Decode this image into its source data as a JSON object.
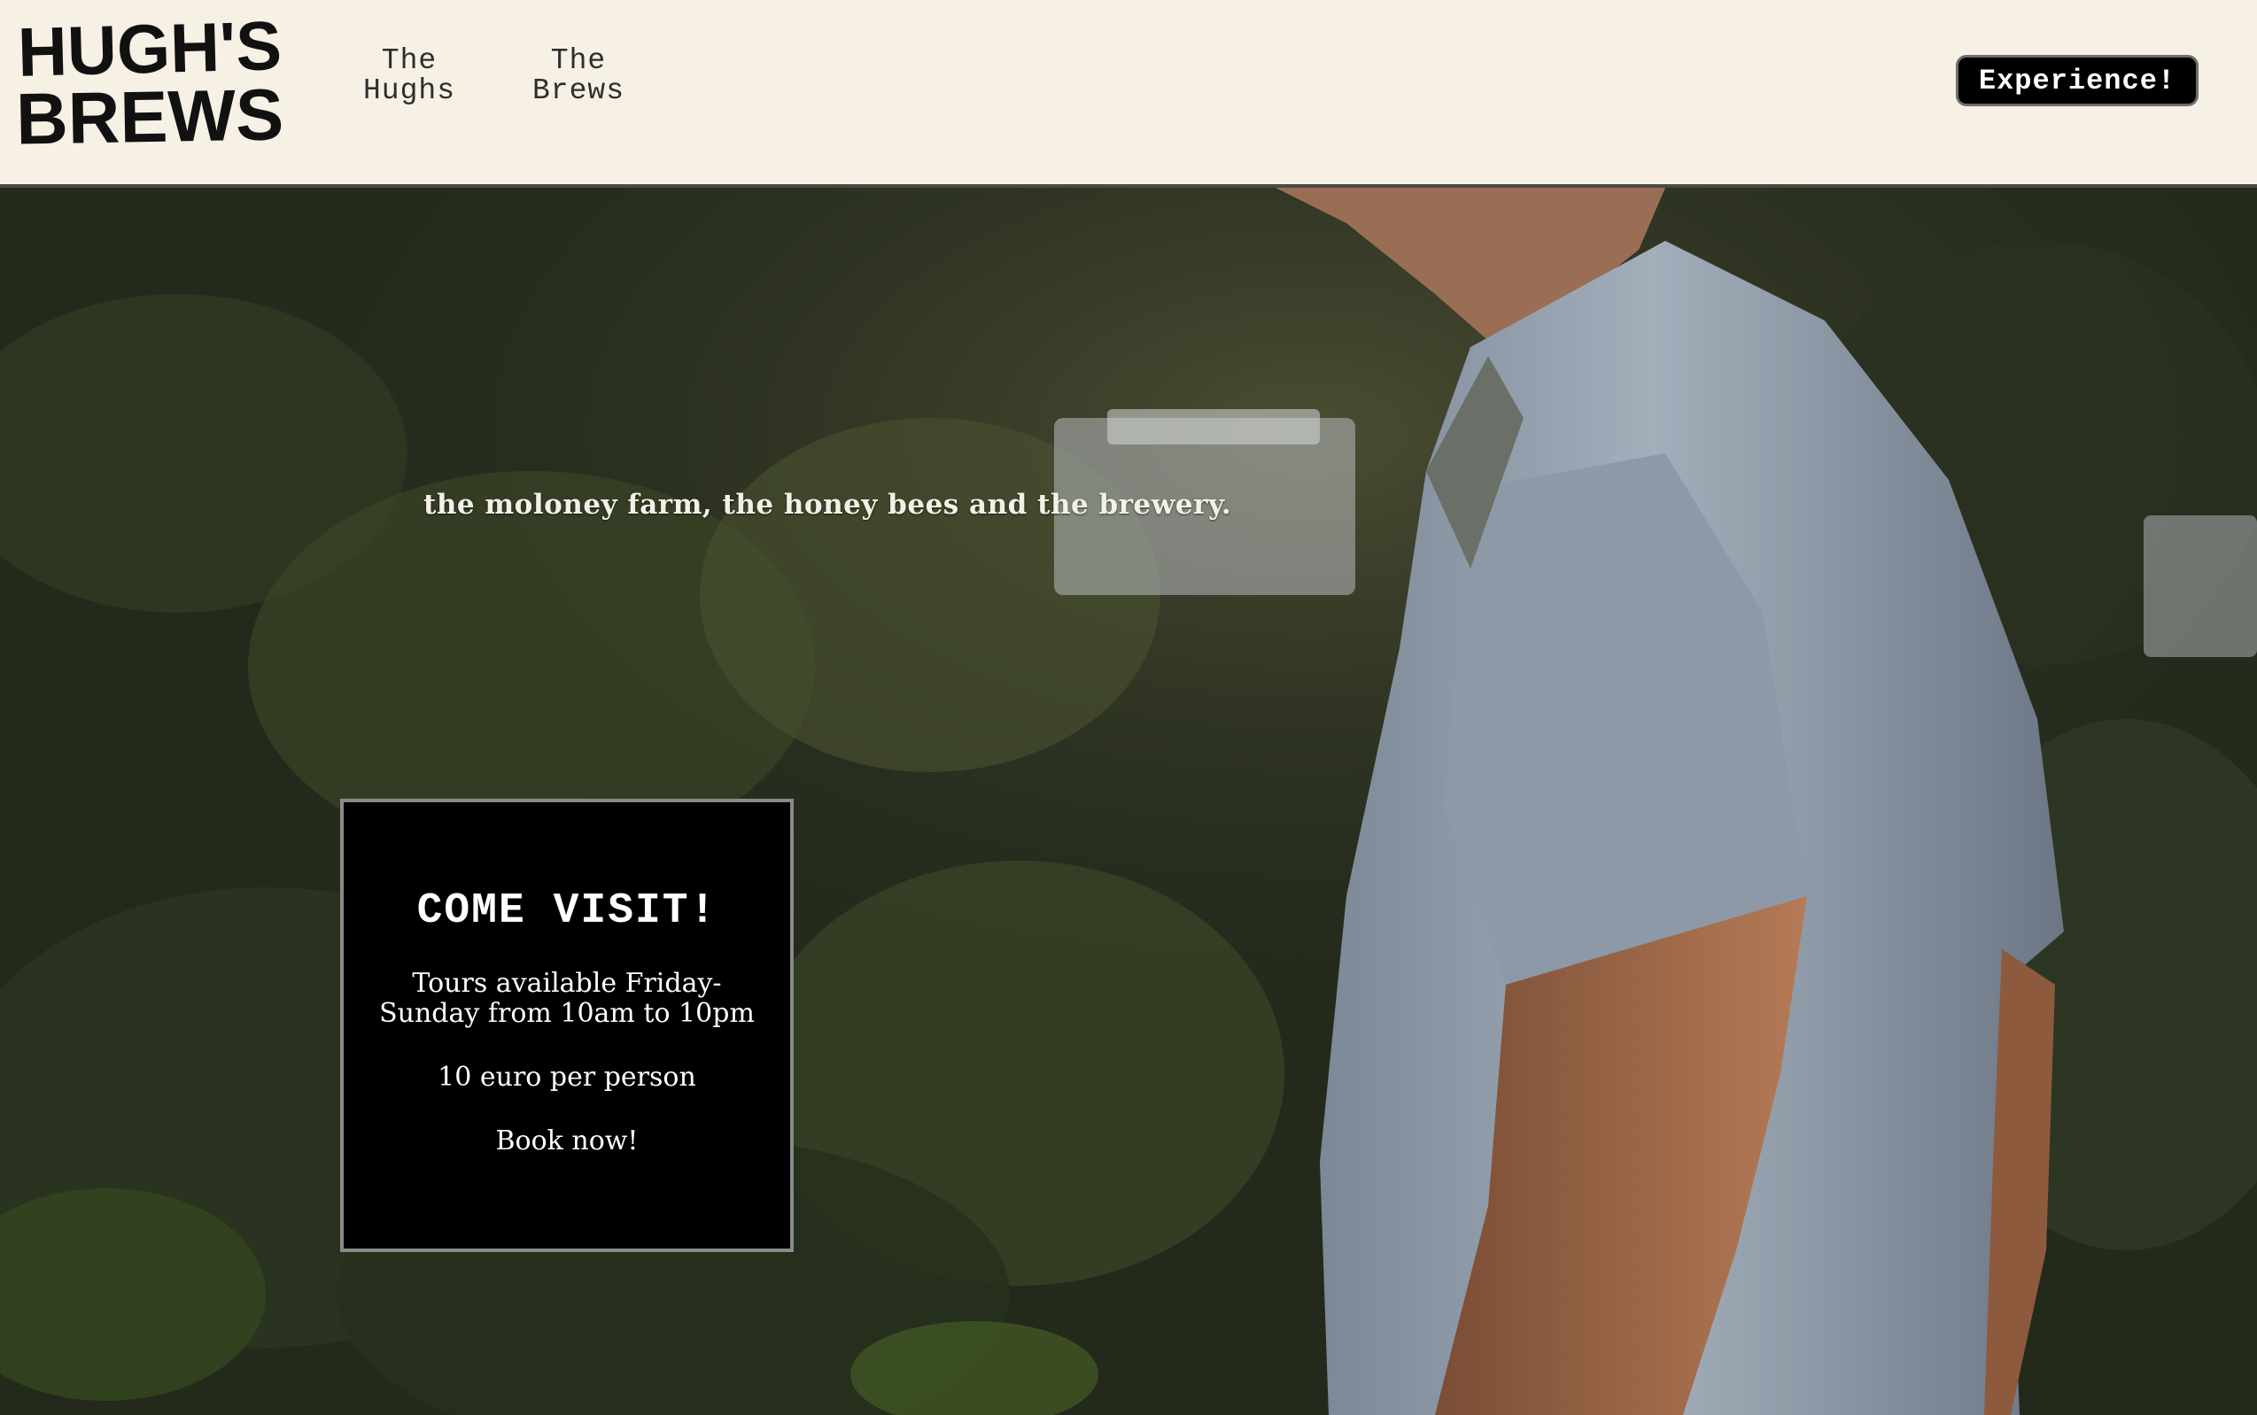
{
  "header": {
    "logo_line1": "HUGH'S",
    "logo_line2": "BREWS",
    "nav": [
      {
        "label": "The\nHughs"
      },
      {
        "label": "The\nBrews"
      }
    ],
    "cta_label": "Experience!"
  },
  "hero": {
    "tagline": "the moloney farm, the honey bees and the brewery.",
    "visit_card": {
      "title": "COME VISIT!",
      "tours": "Tours available Friday-Sunday from 10am to 10pm",
      "price": "10 euro per person",
      "book": "Book now!"
    }
  },
  "colors": {
    "header_bg": "#f6f0e5",
    "cta_bg": "#000000",
    "card_bg": "#000000",
    "text_light": "#ffffff"
  }
}
